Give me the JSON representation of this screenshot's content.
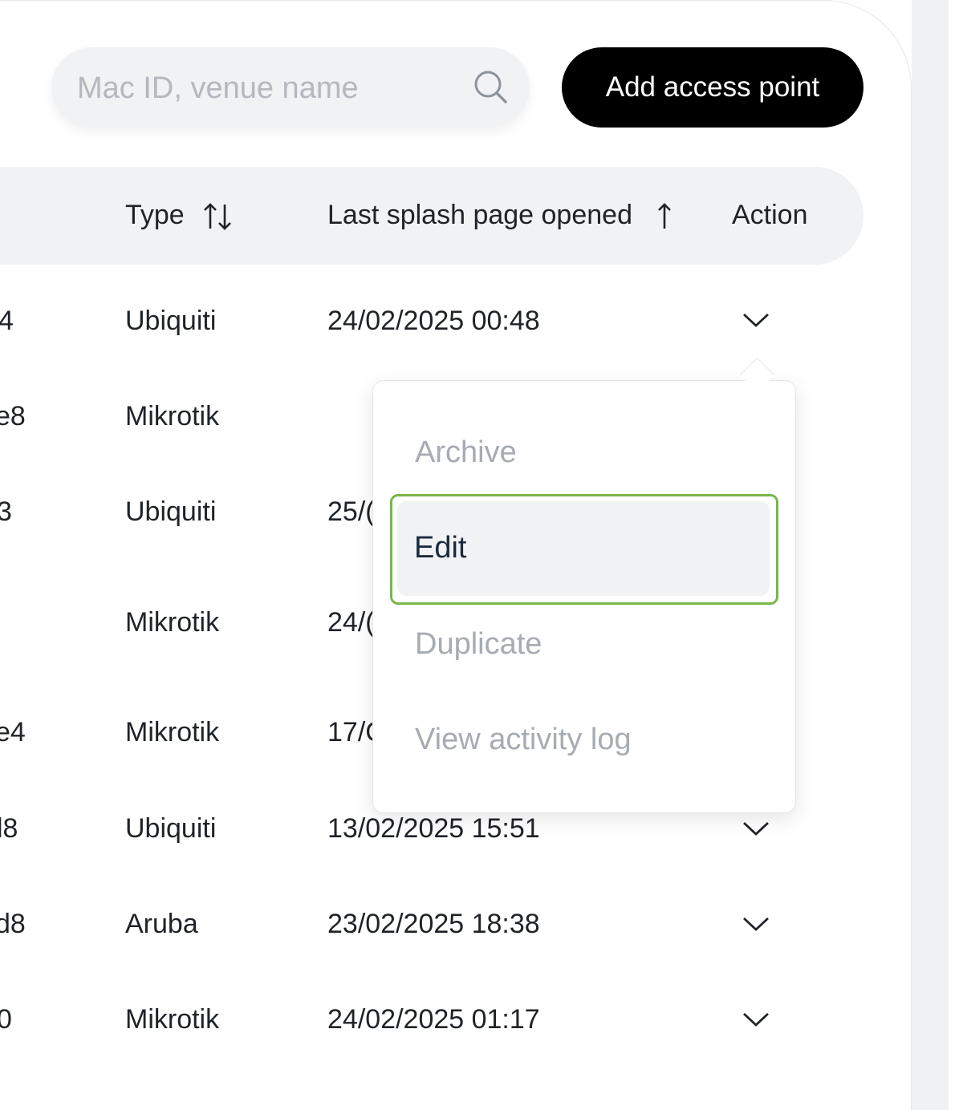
{
  "search": {
    "placeholder": "Mac ID, venue name"
  },
  "toolbar": {
    "add_label": "Add access point"
  },
  "table": {
    "columns": {
      "type": "Type",
      "last_splash": "Last splash page opened",
      "action": "Action"
    },
    "rows": [
      {
        "id_fragment": "4",
        "type": "Ubiquiti",
        "last_splash": "24/02/2025 00:48"
      },
      {
        "id_fragment": "e8",
        "type": "Mikrotik",
        "last_splash": ""
      },
      {
        "id_fragment": "3",
        "type": "Ubiquiti",
        "last_splash": "25/("
      },
      {
        "id_fragment": "",
        "type": "Mikrotik",
        "last_splash": "24/("
      },
      {
        "id_fragment": "e4",
        "type": "Mikrotik",
        "last_splash": "17/C"
      },
      {
        "id_fragment": "l8",
        "type": "Ubiquiti",
        "last_splash": "13/02/2025 15:51"
      },
      {
        "id_fragment": "d8",
        "type": "Aruba",
        "last_splash": "23/02/2025 18:38"
      },
      {
        "id_fragment": "0",
        "type": "Mikrotik",
        "last_splash": "24/02/2025 01:17"
      }
    ]
  },
  "action_menu": {
    "items": [
      "Archive",
      "Edit",
      "Duplicate",
      "View activity log"
    ],
    "highlighted": "Edit"
  },
  "colors": {
    "button_bg": "#000000",
    "header_bg": "#f1f2f4",
    "highlight_outline": "#7ab648",
    "menu_text_muted": "#a7abb2",
    "menu_text_active": "#1b2a3e"
  }
}
